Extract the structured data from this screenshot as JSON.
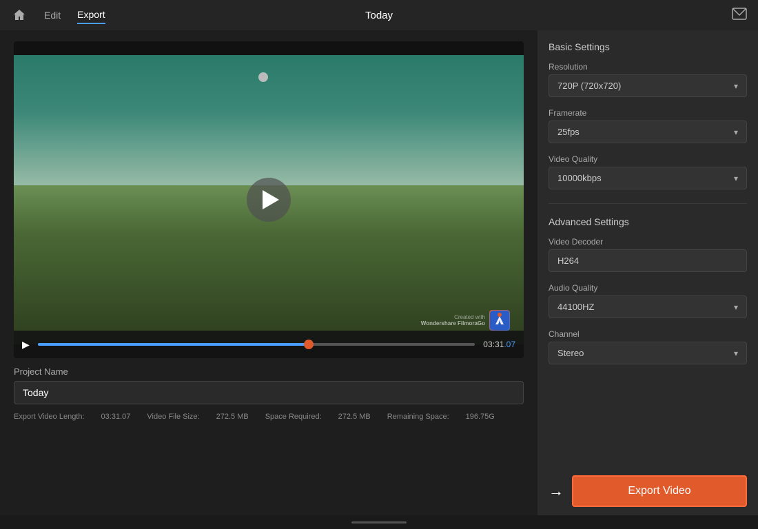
{
  "nav": {
    "edit_label": "Edit",
    "export_label": "Export",
    "title": "Today",
    "active_tab": "Export"
  },
  "video": {
    "time_current": "03:31",
    "time_suffix": ".07",
    "progress_percent": 62
  },
  "project": {
    "name_label": "Project Name",
    "name_value": "Today"
  },
  "export_info": {
    "video_length_label": "Export Video Length:",
    "video_length_value": "03:31.07",
    "file_size_label": "Video File Size:",
    "file_size_value": "272.5 MB",
    "space_required_label": "Space Required:",
    "space_required_value": "272.5 MB",
    "remaining_label": "Remaining Space:",
    "remaining_value": "196.75G"
  },
  "settings": {
    "basic_title": "Basic Settings",
    "resolution_label": "Resolution",
    "resolution_value": "720P (720x720)",
    "framerate_label": "Framerate",
    "framerate_value": "25fps",
    "video_quality_label": "Video Quality",
    "video_quality_value": "10000kbps",
    "advanced_title": "Advanced Settings",
    "video_decoder_label": "Video Decoder",
    "video_decoder_value": "H264",
    "audio_quality_label": "Audio Quality",
    "audio_quality_value": "44100HZ",
    "channel_label": "Channel",
    "channel_value": "Stereo"
  },
  "buttons": {
    "export_label": "Export Video"
  },
  "watermark": {
    "created_with": "Created with",
    "brand": "Wondershare FilmoraGo"
  }
}
